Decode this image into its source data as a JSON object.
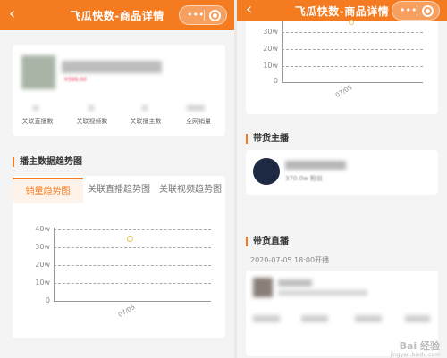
{
  "nav": {
    "back_icon": "‹",
    "title": "飞瓜快数-商品详情",
    "dots": "•••"
  },
  "product": {
    "price_tag": "¥399.00",
    "stats": [
      {
        "label": "关联直播数"
      },
      {
        "label": "关联视频数"
      },
      {
        "label": "关联播主数"
      },
      {
        "label": "全网销量"
      }
    ]
  },
  "trend_section": {
    "title": "播主数据趋势图",
    "tabs": [
      {
        "label": "销量趋势图",
        "active": true
      },
      {
        "label": "关联直播趋势图",
        "active": false
      },
      {
        "label": "关联视频趋势图",
        "active": false
      }
    ]
  },
  "chart_data": {
    "type": "scatter",
    "x": [
      "07/05"
    ],
    "series": [
      {
        "values": [
          35
        ]
      }
    ],
    "yticks": [
      "40w",
      "30w",
      "20w",
      "10w",
      "0"
    ],
    "ylim": [
      0,
      40
    ],
    "grid": true
  },
  "right_chart": {
    "yticks": [
      "30w",
      "20w",
      "10w",
      "0"
    ],
    "xtick": "07/05"
  },
  "anchor_section": {
    "title": "带货主播",
    "anchor_note": "370.0w 粉丝"
  },
  "live_section": {
    "title": "带货直播",
    "live_time": "2020-07-05 18:00开播"
  },
  "watermark": {
    "main": "Bai 经验",
    "sub": "jingyan.baidu.com"
  },
  "colors": {
    "brand": "#f47b20",
    "scatter_point": "#f2c45a"
  }
}
